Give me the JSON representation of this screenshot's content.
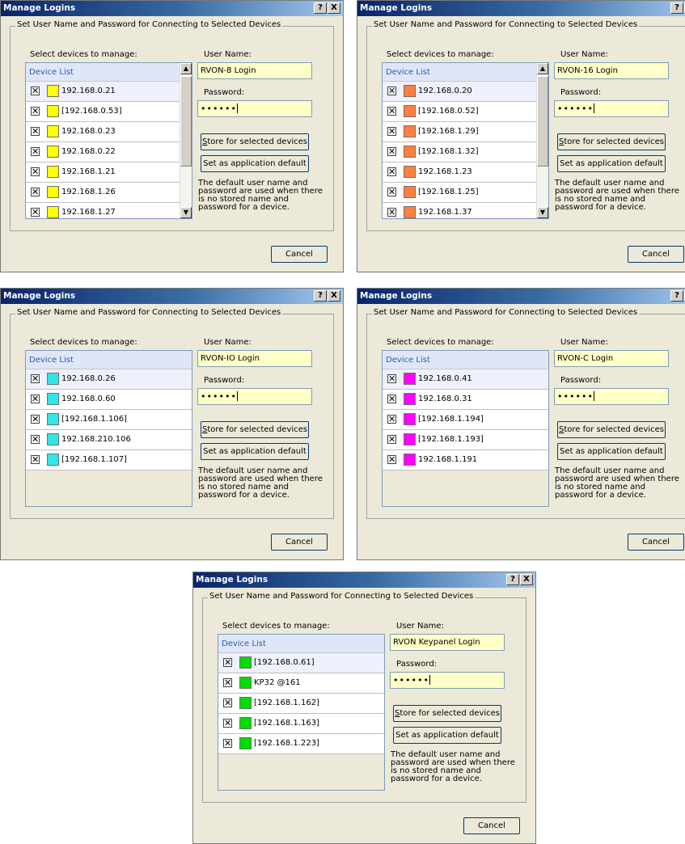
{
  "shared": {
    "window_title": "Manage Logins",
    "help_button": "?",
    "close_button": "X",
    "group_label": "Set User Name and Password for Connecting to Selected Devices",
    "select_devices_label": "Select devices to manage:",
    "device_list_header": "Device List",
    "user_name_label": "User Name:",
    "password_label": "Password:",
    "password_mask": "••••••",
    "store_button_accel": "S",
    "store_button_rest": "tore for selected devices",
    "default_button": "Set as application default",
    "note": "The default user name and password are used when there is no stored name and password for a device.",
    "cancel_button": "Cancel",
    "check_glyph": "✕"
  },
  "dialogs": [
    {
      "user_name": "RVON-8 Login",
      "swatch_color": "#ffff00",
      "has_scrollbar": true,
      "devices": [
        "192.168.0.21",
        "[192.168.0.53]",
        "192.168.0.23",
        "192.168.0.22",
        "192.168.1.21",
        "192.168.1.26",
        "192.168.1.27"
      ]
    },
    {
      "user_name": "RVON-16 Login",
      "swatch_color": "#ff7f3f",
      "has_scrollbar": true,
      "devices": [
        "192.168.0.20",
        "[192.168.0.52]",
        "[192.168.1.29]",
        "[192.168.1.32]",
        "192.168.1.23",
        "[192.168.1.25]",
        "192.168.1.37"
      ]
    },
    {
      "user_name": "RVON-IO Login",
      "swatch_color": "#33e6e6",
      "has_scrollbar": false,
      "devices": [
        "192.168.0.26",
        "192.168.0.60",
        "[192.168.1.106]",
        "192.168.210.106",
        "[192.168.1.107]"
      ]
    },
    {
      "user_name": "RVON-C Login",
      "swatch_color": "#ff00ff",
      "has_scrollbar": false,
      "devices": [
        "192.168.0.41",
        "192.168.0.31",
        "[192.168.1.194]",
        "[192.168.1.193]",
        "192.168.1.191"
      ]
    },
    {
      "user_name": "RVON Keypanel Login",
      "swatch_color": "#00dd00",
      "has_scrollbar": false,
      "devices": [
        "[192.168.0.61]",
        "KP32 @161",
        "[192.168.1.162]",
        "[192.168.1.163]",
        "[192.168.1.223]"
      ]
    }
  ]
}
